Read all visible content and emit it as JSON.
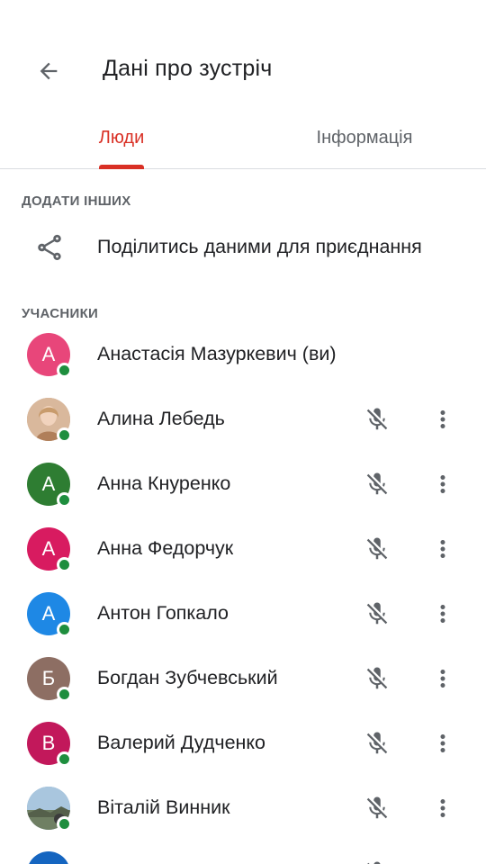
{
  "header": {
    "title": "Дані про зустріч"
  },
  "tabs": [
    {
      "label": "Люди",
      "active": true
    },
    {
      "label": "Інформація",
      "active": false
    }
  ],
  "sections": {
    "add_others": "ДОДАТИ ІНШИХ",
    "participants": "УЧАСНИКИ"
  },
  "share": {
    "label": "Поділитись даними для приєднання",
    "icon": "share-icon"
  },
  "participants": [
    {
      "name": "Анастасія Мазуркевич (ви)",
      "initial": "А",
      "color": "#e8467a",
      "photo": false,
      "is_self": true
    },
    {
      "name": "Алина Лебедь",
      "initial": "",
      "color": "#c9a48a",
      "photo": true,
      "is_self": false
    },
    {
      "name": "Анна Кнуренко",
      "initial": "А",
      "color": "#2e7d32",
      "photo": false,
      "is_self": false
    },
    {
      "name": "Анна Федорчук",
      "initial": "А",
      "color": "#d81b60",
      "photo": false,
      "is_self": false
    },
    {
      "name": "Антон Гопкало",
      "initial": "А",
      "color": "#1e88e5",
      "photo": false,
      "is_self": false
    },
    {
      "name": "Богдан Зубчевський",
      "initial": "Б",
      "color": "#8d6e63",
      "photo": false,
      "is_self": false
    },
    {
      "name": "Валерий Дудченко",
      "initial": "В",
      "color": "#c2185b",
      "photo": false,
      "is_self": false
    },
    {
      "name": "Віталій Винник",
      "initial": "",
      "color": "#7fa8c9",
      "photo": true,
      "is_self": false
    },
    {
      "name": "",
      "initial": "",
      "color": "#1565c0",
      "photo": false,
      "is_self": false
    }
  ],
  "colors": {
    "accent": "#d93025",
    "online": "#1e8e3e",
    "secondary_text": "#5f6368",
    "divider": "#dadce0"
  }
}
